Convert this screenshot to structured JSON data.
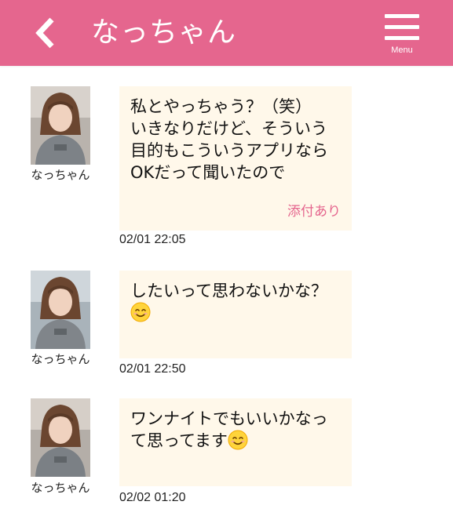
{
  "header": {
    "title": "なっちゃん",
    "back_icon": "chevron-left-icon",
    "menu_icon": "hamburger-menu-icon",
    "menu_label": "Menu",
    "bg_color": "#e5668e"
  },
  "messages": [
    {
      "sender": "なっちゃん",
      "text": "私とやっちゃう？（笑）\nいきなりだけど、そういう目的もこういうアプリならOKだって聞いたので",
      "attachment_label": "添付あり",
      "time": "02/01 22:05"
    },
    {
      "sender": "なっちゃん",
      "text": "したいって思わないかな？",
      "emoji": "smiling-face-emoji",
      "time": "02/01 22:50"
    },
    {
      "sender": "なっちゃん",
      "text": "ワンナイトでもいいかなって思ってます",
      "emoji": "smiling-face-emoji",
      "time": "02/02 01:20"
    }
  ],
  "colors": {
    "accent": "#e5668e",
    "bubble_bg": "#fff8ea"
  }
}
